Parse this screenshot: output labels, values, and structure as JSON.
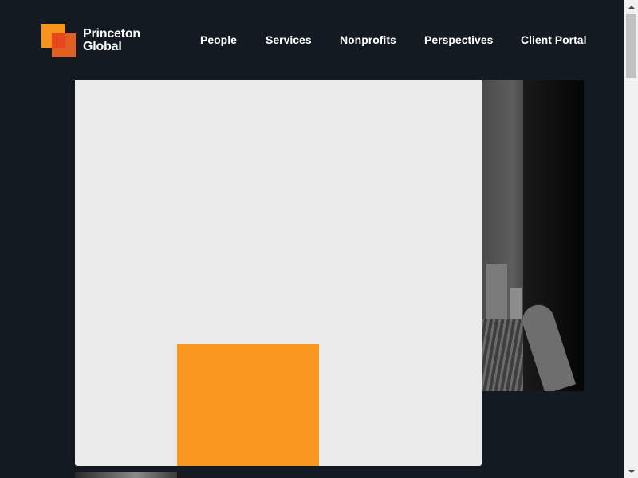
{
  "brand": {
    "line1": "Princeton",
    "line2": "Global",
    "colors": {
      "orange": "#f7941d",
      "red_orange": "#f26522",
      "background": "#141a22"
    }
  },
  "nav": {
    "items": [
      {
        "label": "People"
      },
      {
        "label": "Services"
      },
      {
        "label": "Nonprofits"
      },
      {
        "label": "Perspectives"
      },
      {
        "label": "Client Portal"
      }
    ]
  },
  "content": {
    "panel_color": "#ebebeb",
    "accent_block_color": "#f7971f",
    "photo": "black-and-white city view from window"
  },
  "icons": {
    "scroll_up": "scroll-up-arrow-icon",
    "scroll_down": "scroll-down-arrow-icon"
  }
}
